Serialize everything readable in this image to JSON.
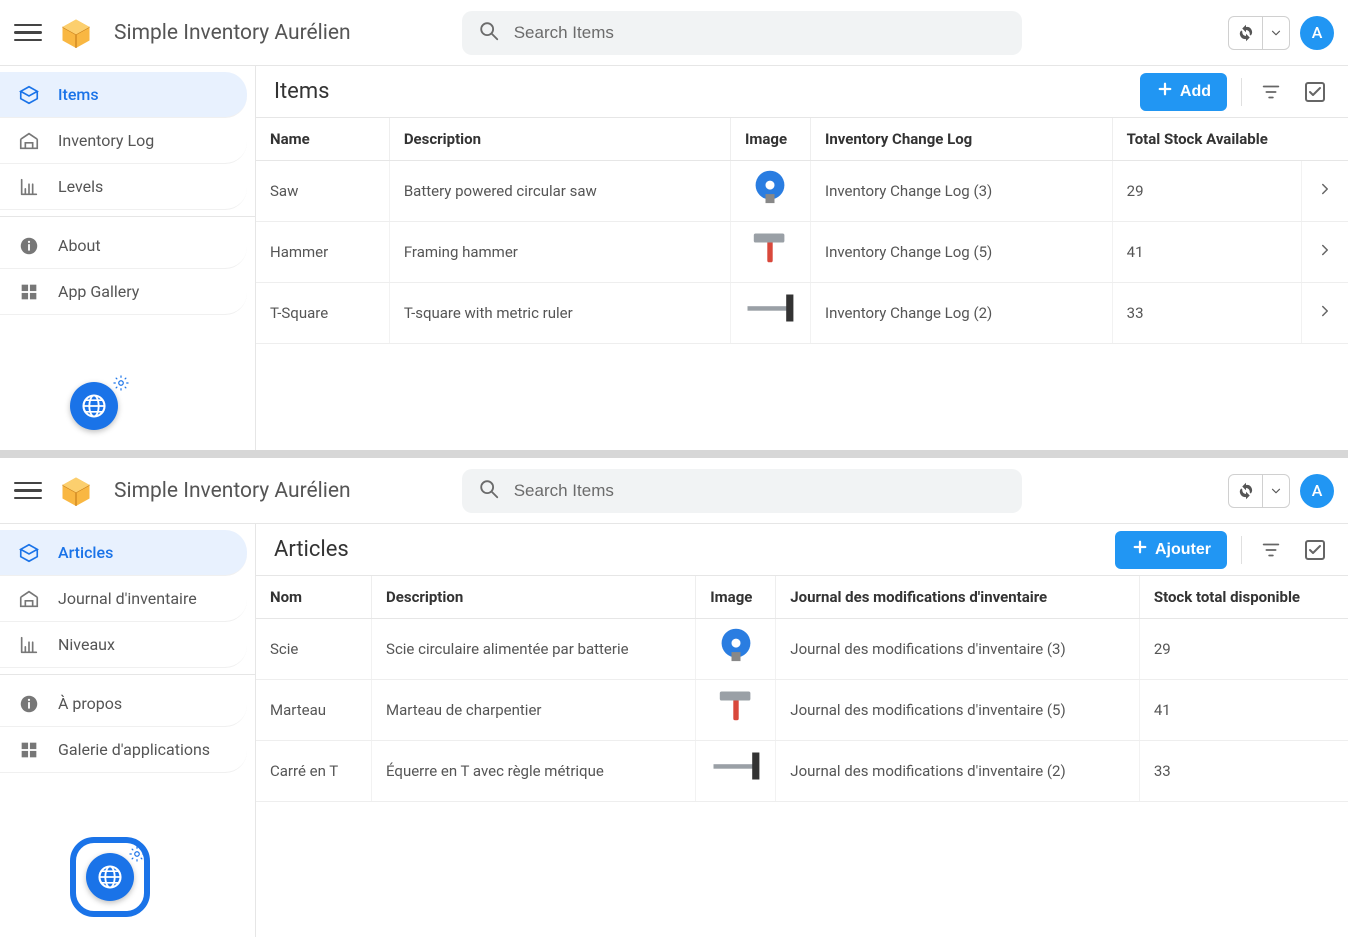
{
  "app_title": "Simple Inventory Aurélien",
  "search_placeholder": "Search Items",
  "avatar_letter": "A",
  "panels": {
    "en": {
      "sidebar": [
        {
          "label": "Items",
          "active": true,
          "icon": "boxes"
        },
        {
          "label": "Inventory Log",
          "active": false,
          "icon": "warehouse"
        },
        {
          "label": "Levels",
          "active": false,
          "icon": "chart"
        },
        {
          "label": "About",
          "active": false,
          "icon": "info"
        },
        {
          "label": "App Gallery",
          "active": false,
          "icon": "grid"
        }
      ],
      "page_title": "Items",
      "add_label": "Add",
      "columns": {
        "name": "Name",
        "description": "Description",
        "image": "Image",
        "changelog": "Inventory Change Log",
        "stock": "Total Stock Available"
      },
      "rows": [
        {
          "name": "Saw",
          "description": "Battery powered circular saw",
          "image": "saw",
          "changelog": "Inventory Change Log (3)",
          "stock": "29"
        },
        {
          "name": "Hammer",
          "description": "Framing hammer",
          "image": "hammer",
          "changelog": "Inventory Change Log (5)",
          "stock": "41"
        },
        {
          "name": "T-Square",
          "description": "T-square with metric ruler",
          "image": "tsquare",
          "changelog": "Inventory Change Log (2)",
          "stock": "33"
        }
      ]
    },
    "fr": {
      "sidebar": [
        {
          "label": "Articles",
          "active": true,
          "icon": "boxes"
        },
        {
          "label": "Journal d'inventaire",
          "active": false,
          "icon": "warehouse"
        },
        {
          "label": "Niveaux",
          "active": false,
          "icon": "chart"
        },
        {
          "label": "À propos",
          "active": false,
          "icon": "info"
        },
        {
          "label": "Galerie d'applications",
          "active": false,
          "icon": "grid"
        }
      ],
      "page_title": "Articles",
      "add_label": "Ajouter",
      "columns": {
        "name": "Nom",
        "description": "Description",
        "image": "Image",
        "changelog": "Journal des modifications d'inventaire",
        "stock": "Stock total disponible"
      },
      "rows": [
        {
          "name": "Scie",
          "description": "Scie circulaire alimentée par batterie",
          "image": "saw",
          "changelog": "Journal des modifications d'inventaire (3)",
          "stock": "29"
        },
        {
          "name": "Marteau",
          "description": "Marteau de charpentier",
          "image": "hammer",
          "changelog": "Journal des modifications d'inventaire (5)",
          "stock": "41"
        },
        {
          "name": "Carré en T",
          "description": "Équerre en T avec règle métrique",
          "image": "tsquare",
          "changelog": "Journal des modifications d'inventaire (2)",
          "stock": "33"
        }
      ]
    }
  }
}
